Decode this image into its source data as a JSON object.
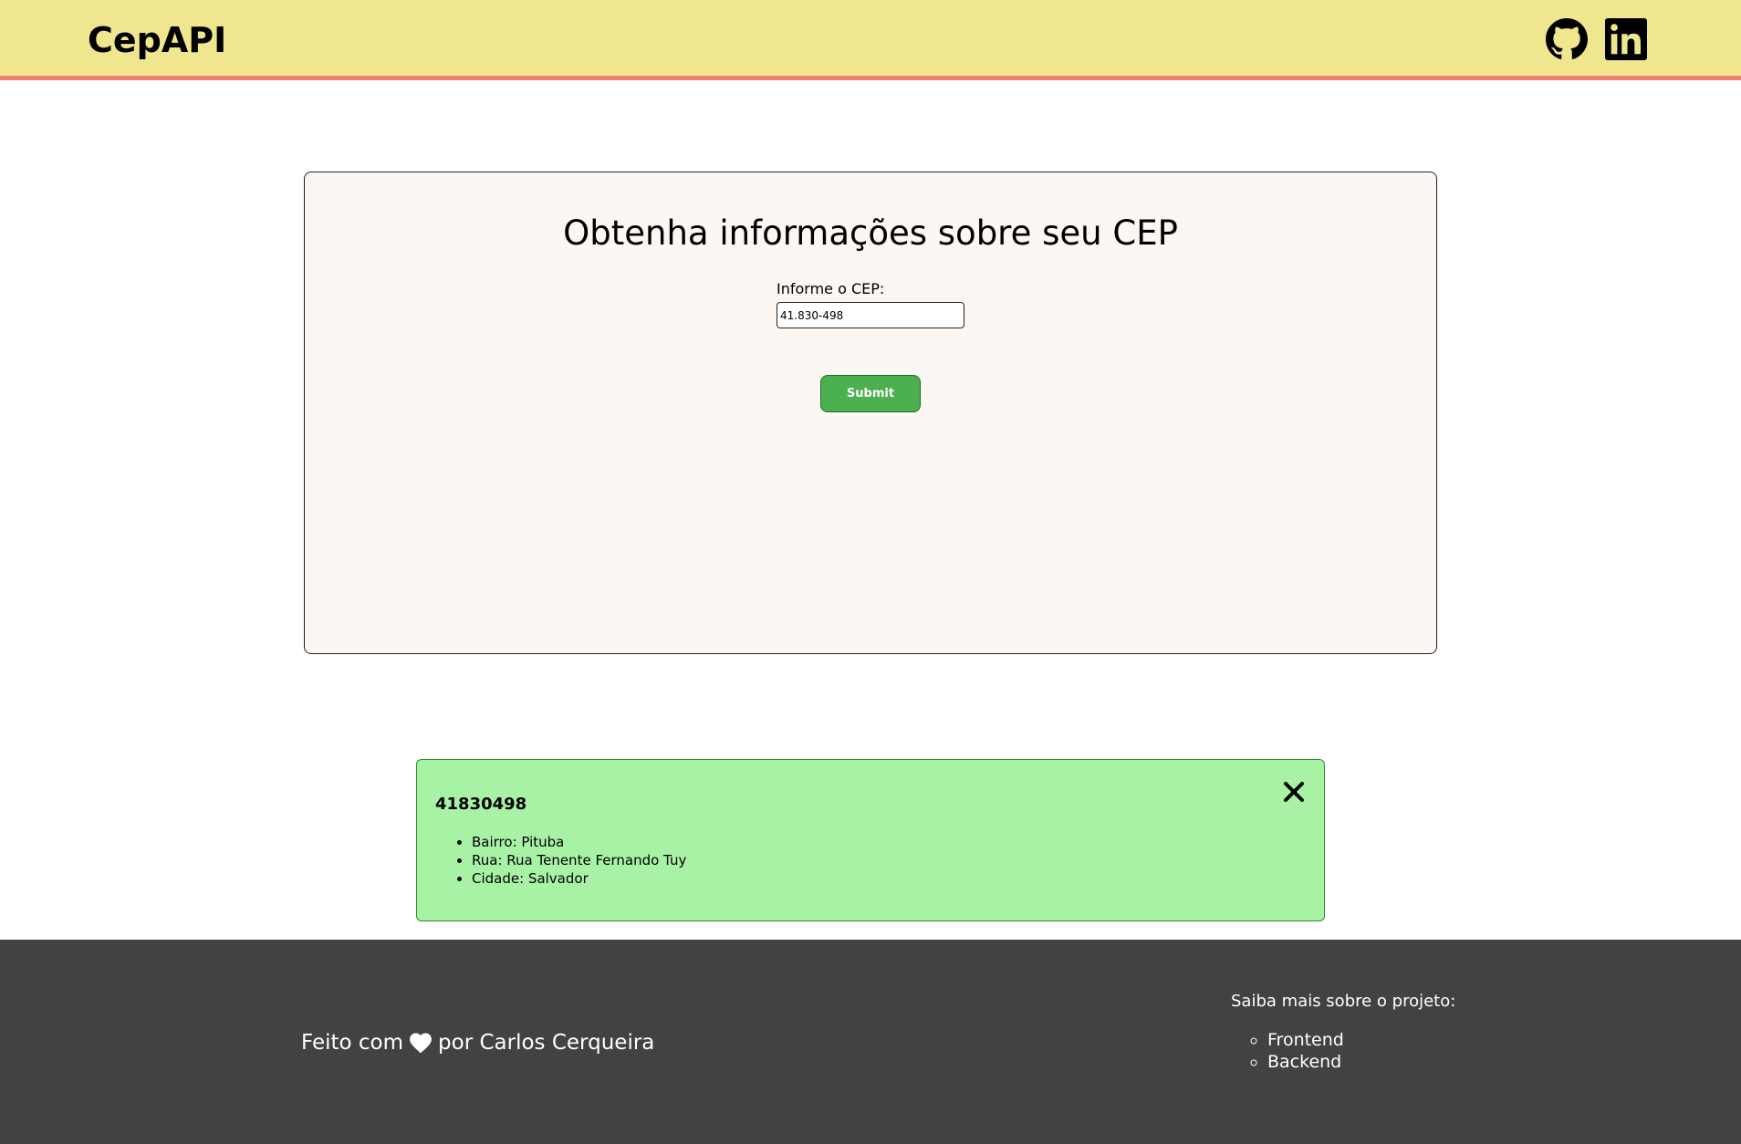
{
  "header": {
    "brand": "CepAPI",
    "icons": [
      "github-icon",
      "linkedin-icon"
    ],
    "background_color": "#efe68f",
    "border_color": "#f08070"
  },
  "form": {
    "title": "Obtenha informações sobre seu CEP",
    "label": "Informe o CEP:",
    "cep_value": "41.830-498",
    "submit_label": "Submit",
    "button_color": "#4caf50"
  },
  "result": {
    "cep": "41830498",
    "items": [
      "Bairro: Pituba",
      "Rua: Rua Tenente Fernando Tuy",
      "Cidade: Salvador"
    ],
    "close_icon": "close-icon",
    "background_color": "#a8f2a6"
  },
  "footer": {
    "credit_prefix": "Feito com",
    "credit_suffix": "por Carlos Cerqueira",
    "heart_icon": "heart-icon",
    "links_title": "Saiba mais sobre o projeto:",
    "links": [
      "Frontend",
      "Backend"
    ],
    "background_color": "#424242"
  }
}
